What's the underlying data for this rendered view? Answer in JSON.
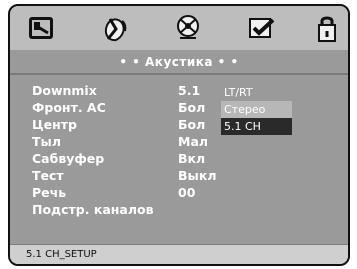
{
  "header": {
    "tabs": [
      {
        "icon": "film-icon"
      },
      {
        "icon": "speaker-icon"
      },
      {
        "icon": "disc-icon"
      },
      {
        "icon": "checkbox-icon"
      },
      {
        "icon": "lock-icon"
      }
    ]
  },
  "section": {
    "title": "• • Акустика • •"
  },
  "menu": {
    "rows": [
      {
        "label": "Downmix",
        "value": "5.1"
      },
      {
        "label": "Фронт. АС",
        "value": "Бол"
      },
      {
        "label": "Центр",
        "value": "Бол"
      },
      {
        "label": "Тыл",
        "value": "Мал"
      },
      {
        "label": "Сабвуфер",
        "value": "Вкл"
      },
      {
        "label": "Тест",
        "value": "Выкл"
      },
      {
        "label": "Речь",
        "value": "00"
      },
      {
        "label": "Подстр. каналов",
        "value": ""
      }
    ]
  },
  "popup": {
    "options": [
      "LT/RT",
      "Стерео",
      "5.1 CH"
    ],
    "selected": "5.1 CH"
  },
  "status": {
    "text": "5.1 CH_SETUP"
  }
}
